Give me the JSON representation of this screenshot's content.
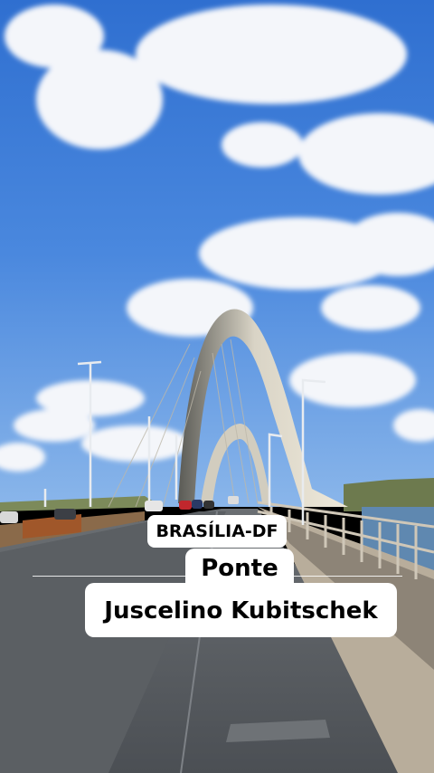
{
  "photo": {
    "subject": "Ponte Juscelino Kubitschek",
    "sky_color": "#3f7fd6",
    "road_color": "#55595e"
  },
  "captions": {
    "location": "BRASÍLIA-DF",
    "title_line1": "Ponte",
    "title_line2": "Juscelino Kubitschek"
  }
}
